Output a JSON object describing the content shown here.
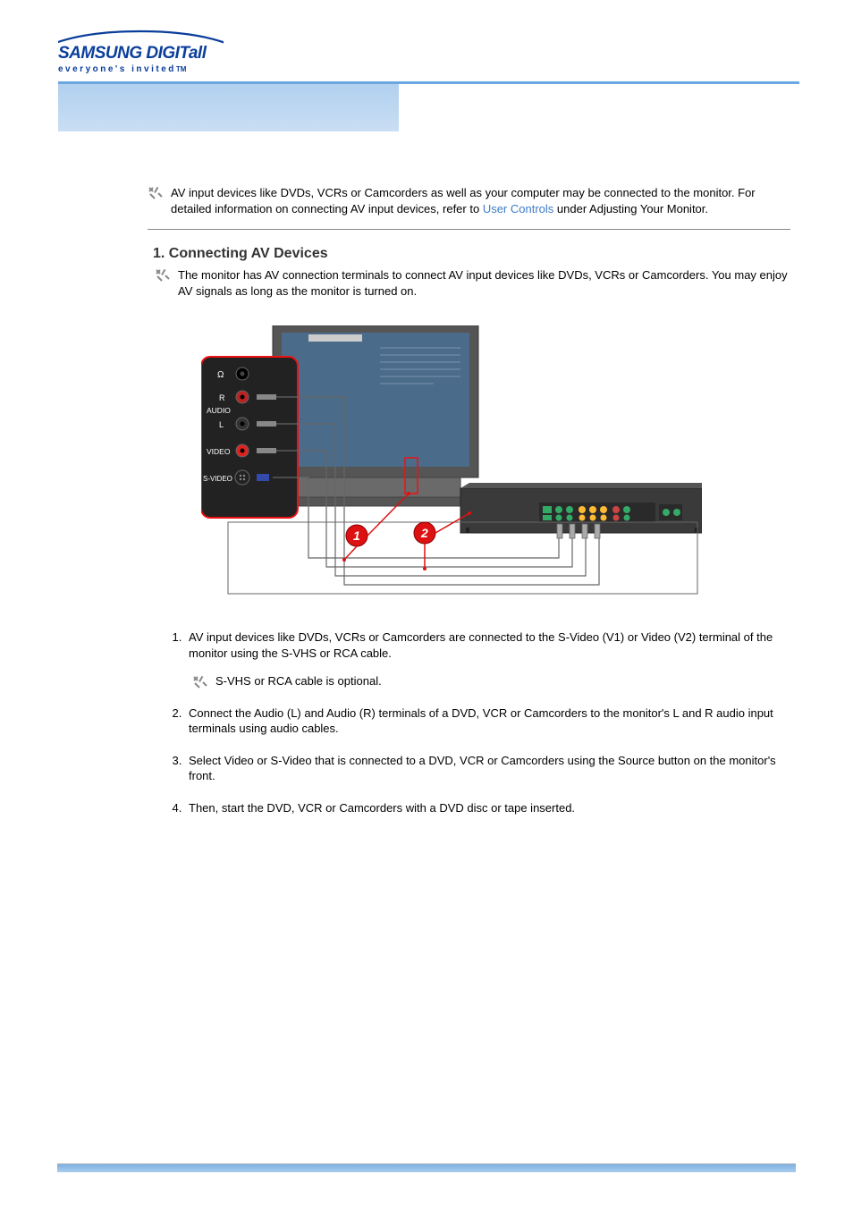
{
  "logo": {
    "line1": "SAMSUNG DIGITall",
    "line2": "everyone's invited",
    "tm": "TM"
  },
  "intro": {
    "pre": "AV input devices like DVDs, VCRs or Camcorders as well as your computer may be connected to the monitor. For detailed information on connecting AV input devices, refer to ",
    "link": "User Controls",
    "post": " under Adjusting Your Monitor."
  },
  "section": {
    "title": "1. Connecting AV Devices",
    "desc": "The monitor has AV connection terminals to connect AV input devices like DVDs, VCRs or Camcorders. You may enjoy AV signals as long as the monitor is turned on."
  },
  "diagram_labels": {
    "audio_r": "R",
    "audio_label": "AUDIO",
    "audio_l": "L",
    "video": "VIDEO",
    "svideo": "S-VIDEO",
    "call1": "1",
    "call2": "2"
  },
  "steps": [
    {
      "text": "AV input devices like DVDs, VCRs or Camcorders are connected to the S-Video (V1) or Video (V2) terminal of the monitor using the S-VHS or RCA cable.",
      "note": "S-VHS or RCA cable is optional."
    },
    {
      "text": "Connect the Audio (L) and Audio (R) terminals of a DVD, VCR or Camcorders to the monitor's L and R audio input terminals using audio cables."
    },
    {
      "text": "Select Video or S-Video that is connected to a DVD, VCR or Camcorders using the Source button on the monitor's front."
    },
    {
      "text": "Then, start the DVD, VCR or Camcorders with a DVD disc or tape inserted."
    }
  ]
}
